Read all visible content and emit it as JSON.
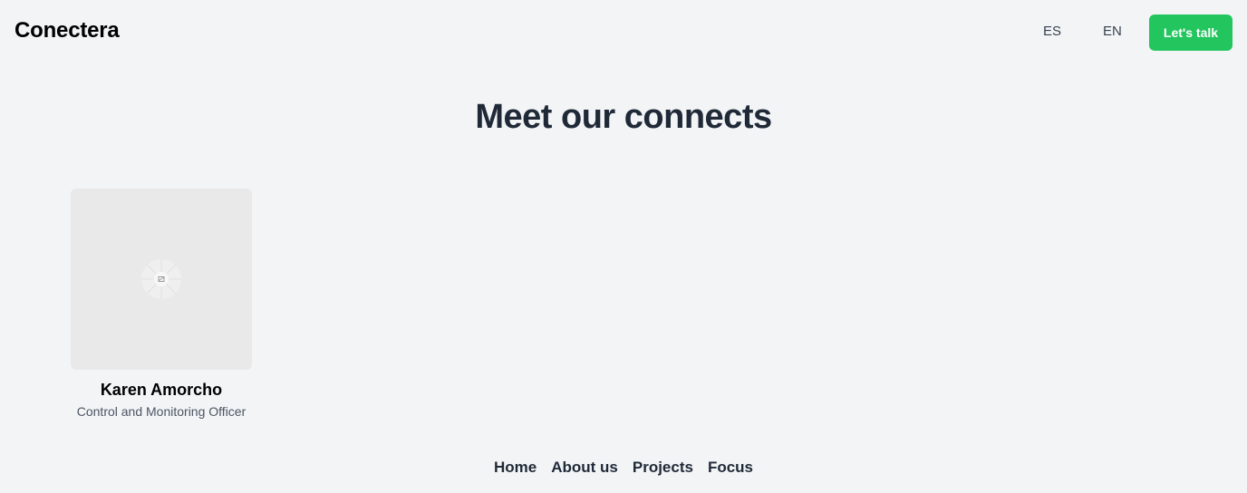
{
  "header": {
    "brand": "Conectera",
    "languages": [
      "ES",
      "EN"
    ],
    "cta_label": "Let's talk"
  },
  "main": {
    "title": "Meet our connects",
    "team": [
      {
        "name": "Karen Amorcho",
        "role": "Control and Monitoring Officer",
        "photo_icon": "image-placeholder-icon"
      }
    ]
  },
  "footer": {
    "nav": [
      "Home",
      "About us",
      "Projects",
      "Focus"
    ]
  },
  "colors": {
    "background": "#f3f4f6",
    "accent": "#22c55e",
    "heading": "#1f2937",
    "photo_placeholder": "#e9e9ea"
  }
}
